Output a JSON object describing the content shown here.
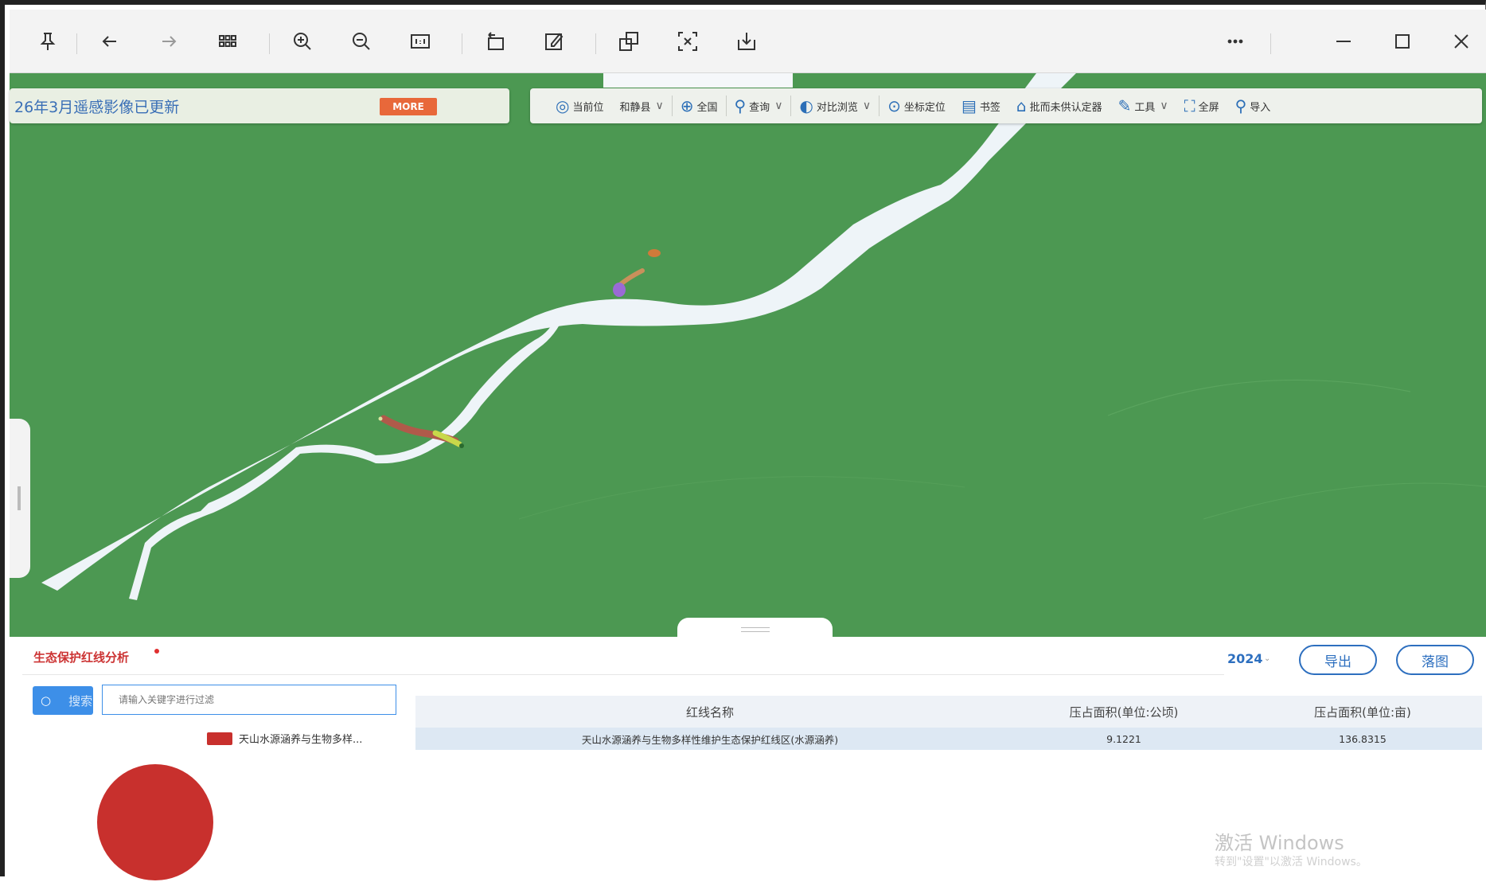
{
  "viewer": {
    "buttons": [
      {
        "name": "pin-icon"
      },
      {
        "name": "back-arrow-icon"
      },
      {
        "name": "forward-arrow-icon"
      },
      {
        "name": "grid-view-icon"
      },
      {
        "name": "zoom-in-icon"
      },
      {
        "name": "zoom-out-icon"
      },
      {
        "name": "actual-size-icon"
      },
      {
        "name": "rotate-icon"
      },
      {
        "name": "edit-icon"
      },
      {
        "name": "crop-icon"
      },
      {
        "name": "text-recognition-icon"
      },
      {
        "name": "save-icon"
      },
      {
        "name": "more-icon"
      },
      {
        "name": "minimize-icon"
      },
      {
        "name": "maximize-icon"
      },
      {
        "name": "close-icon"
      }
    ]
  },
  "notice": {
    "text": "26年3月遥感影像已更新",
    "more": "MORE"
  },
  "map_tools": {
    "locate": "当前位",
    "region": "和静县",
    "full_view": "全国",
    "query": "查询",
    "compare": "对比浏览",
    "coord": "坐标定位",
    "bookmark": "书签",
    "verify": "批而未供认定器",
    "tools": "工具",
    "fullscreen": "全屏",
    "import": "导入"
  },
  "panel": {
    "tab_label": "生态保护红线分析",
    "year": "2024",
    "export_label": "导出",
    "drop_label": "落图",
    "search_label": "搜索",
    "search_placeholder": "请输入关键字进行过滤",
    "legend_label": "天山水源涵养与生物多样..."
  },
  "table": {
    "headers": [
      "红线名称",
      "压占面积(单位:公顷)",
      "压占面积(单位:亩)"
    ],
    "rows": [
      [
        "天山水源涵养与生物多样性维护生态保护红线区(水源涵养)",
        "9.1221",
        "136.8315"
      ]
    ]
  },
  "watermark": {
    "title": "激活 Windows",
    "subtitle": "转到\"设置\"以激活 Windows。"
  },
  "colors": {
    "map_green": "#4c9852",
    "accent_blue": "#2d6fbf",
    "redline": "#c8302d"
  }
}
